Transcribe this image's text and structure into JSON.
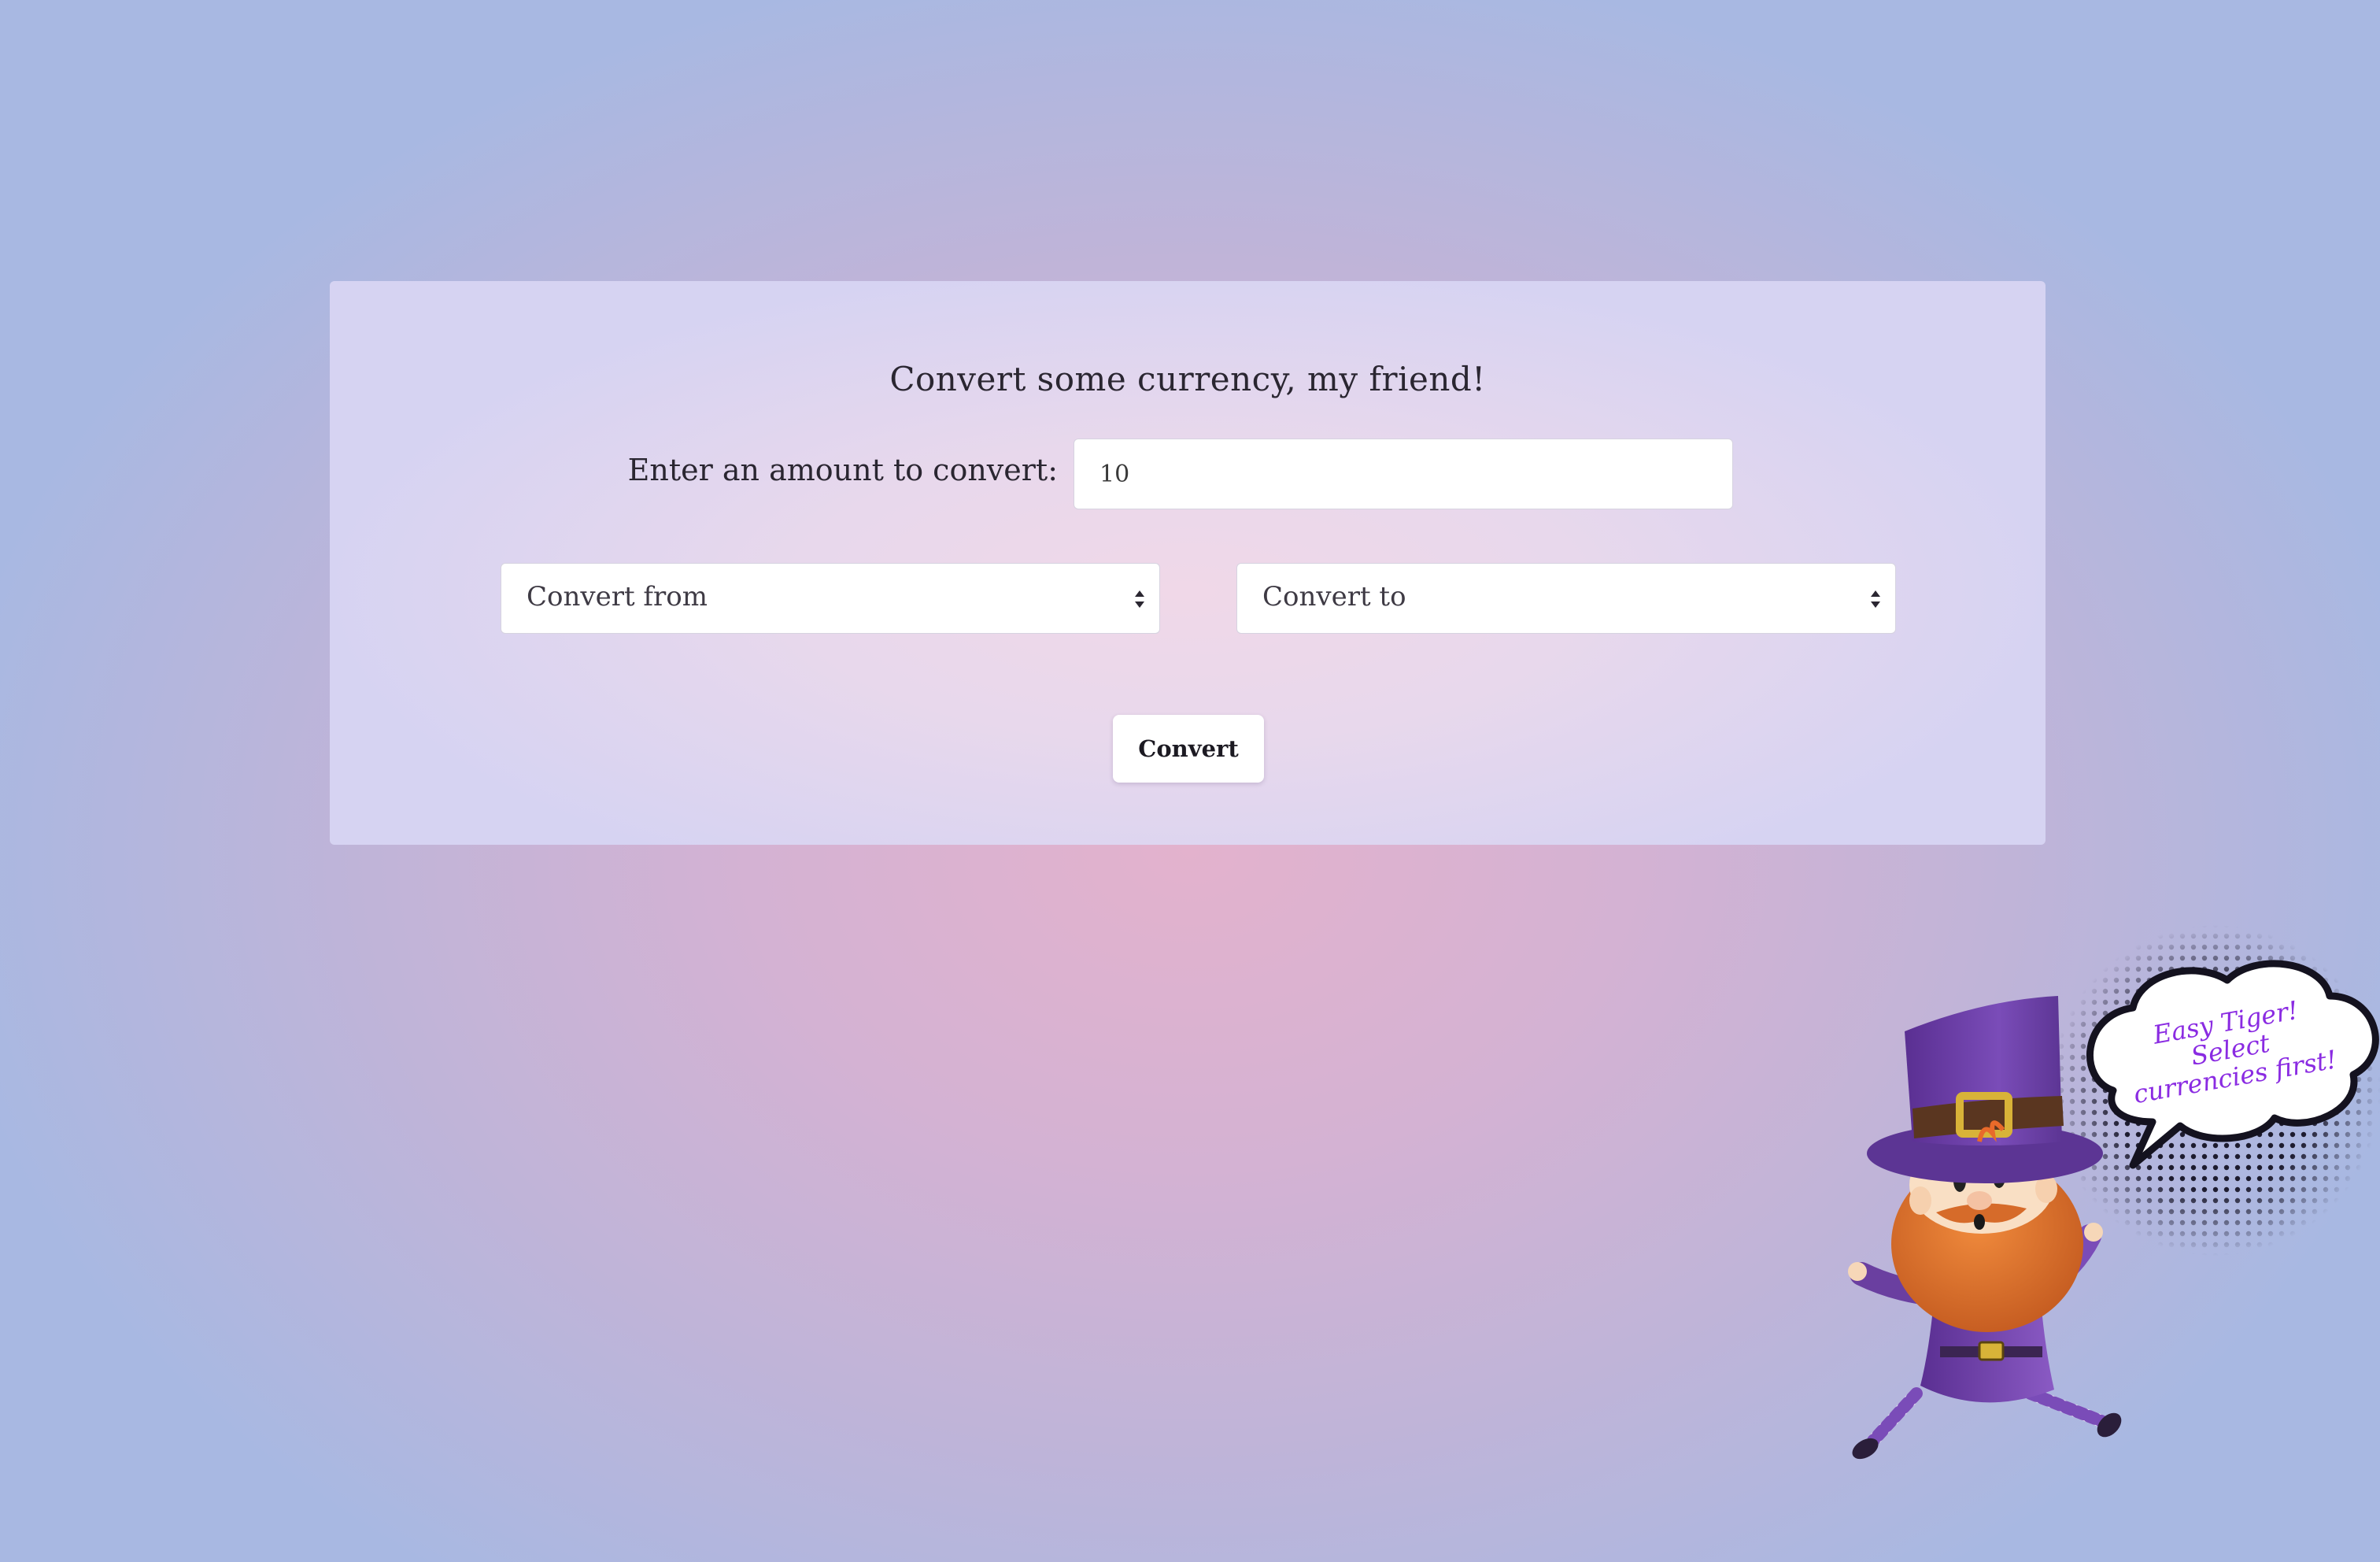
{
  "form": {
    "title": "Convert some currency, my friend!",
    "amount_label": "Enter an amount to convert:",
    "amount_value": "10",
    "from_select": {
      "selected": "Convert from"
    },
    "to_select": {
      "selected": "Convert to"
    },
    "convert_button": "Convert"
  },
  "mascot": {
    "character": "leprechaun",
    "speech_bubble": {
      "line1": "Easy Tiger!",
      "line2": "Select",
      "line3": "currencies first!"
    }
  },
  "colors": {
    "background_center": "#e3b2cd",
    "background_edge": "#a8b8e2",
    "card": "#e8d8ec",
    "hat_purple": "#6a3fa0",
    "beard_orange": "#e07a36",
    "bubble_text": "#8a2be2"
  },
  "icons": {
    "select_arrows": "sort-arrows-icon"
  }
}
